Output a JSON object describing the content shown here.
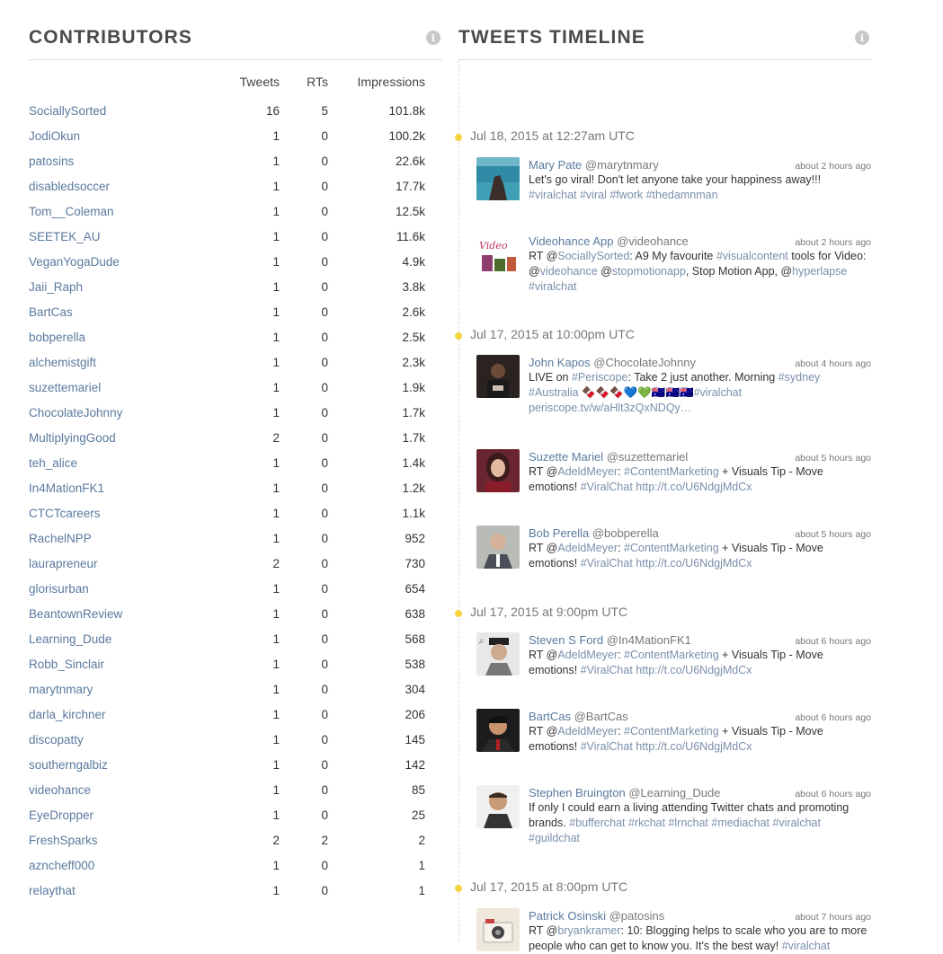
{
  "contributors": {
    "title": "CONTRIBUTORS",
    "info": "i",
    "headers": {
      "name": "",
      "tweets": "Tweets",
      "rts": "RTs",
      "impressions": "Impressions"
    },
    "rows": [
      {
        "name": "SociallySorted",
        "tweets": "16",
        "rts": "5",
        "impressions": "101.8k"
      },
      {
        "name": "JodiOkun",
        "tweets": "1",
        "rts": "0",
        "impressions": "100.2k"
      },
      {
        "name": "patosins",
        "tweets": "1",
        "rts": "0",
        "impressions": "22.6k"
      },
      {
        "name": "disabledsoccer",
        "tweets": "1",
        "rts": "0",
        "impressions": "17.7k"
      },
      {
        "name": "Tom__Coleman",
        "tweets": "1",
        "rts": "0",
        "impressions": "12.5k"
      },
      {
        "name": "SEETEK_AU",
        "tweets": "1",
        "rts": "0",
        "impressions": "11.6k"
      },
      {
        "name": "VeganYogaDude",
        "tweets": "1",
        "rts": "0",
        "impressions": "4.9k"
      },
      {
        "name": "Jaii_Raph",
        "tweets": "1",
        "rts": "0",
        "impressions": "3.8k"
      },
      {
        "name": "BartCas",
        "tweets": "1",
        "rts": "0",
        "impressions": "2.6k"
      },
      {
        "name": "bobperella",
        "tweets": "1",
        "rts": "0",
        "impressions": "2.5k"
      },
      {
        "name": "alchemistgift",
        "tweets": "1",
        "rts": "0",
        "impressions": "2.3k"
      },
      {
        "name": "suzettemariel",
        "tweets": "1",
        "rts": "0",
        "impressions": "1.9k"
      },
      {
        "name": "ChocolateJohnny",
        "tweets": "1",
        "rts": "0",
        "impressions": "1.7k"
      },
      {
        "name": "MultiplyingGood",
        "tweets": "2",
        "rts": "0",
        "impressions": "1.7k"
      },
      {
        "name": "teh_alice",
        "tweets": "1",
        "rts": "0",
        "impressions": "1.4k"
      },
      {
        "name": "In4MationFK1",
        "tweets": "1",
        "rts": "0",
        "impressions": "1.2k"
      },
      {
        "name": "CTCTcareers",
        "tweets": "1",
        "rts": "0",
        "impressions": "1.1k"
      },
      {
        "name": "RachelNPP",
        "tweets": "1",
        "rts": "0",
        "impressions": "952"
      },
      {
        "name": "laurapreneur",
        "tweets": "2",
        "rts": "0",
        "impressions": "730"
      },
      {
        "name": "glorisurban",
        "tweets": "1",
        "rts": "0",
        "impressions": "654"
      },
      {
        "name": "BeantownReview",
        "tweets": "1",
        "rts": "0",
        "impressions": "638"
      },
      {
        "name": "Learning_Dude",
        "tweets": "1",
        "rts": "0",
        "impressions": "568"
      },
      {
        "name": "Robb_Sinclair",
        "tweets": "1",
        "rts": "0",
        "impressions": "538"
      },
      {
        "name": "marytnmary",
        "tweets": "1",
        "rts": "0",
        "impressions": "304"
      },
      {
        "name": "darla_kirchner",
        "tweets": "1",
        "rts": "0",
        "impressions": "206"
      },
      {
        "name": "discopatty",
        "tweets": "1",
        "rts": "0",
        "impressions": "145"
      },
      {
        "name": "southerngalbiz",
        "tweets": "1",
        "rts": "0",
        "impressions": "142"
      },
      {
        "name": "videohance",
        "tweets": "1",
        "rts": "0",
        "impressions": "85"
      },
      {
        "name": "EyeDropper",
        "tweets": "1",
        "rts": "0",
        "impressions": "25"
      },
      {
        "name": "FreshSparks",
        "tweets": "2",
        "rts": "2",
        "impressions": "2"
      },
      {
        "name": "azncheff000",
        "tweets": "1",
        "rts": "0",
        "impressions": "1"
      },
      {
        "name": "relaythat",
        "tweets": "1",
        "rts": "0",
        "impressions": "1"
      }
    ]
  },
  "timeline": {
    "title": "TWEETS TIMELINE",
    "info": "i",
    "groups": [
      {
        "date": "Jul 18, 2015 at 12:27am UTC",
        "tweets": [
          {
            "name": "Mary Pate",
            "handle": "@marytnmary",
            "time": "about 2 hours ago",
            "avatar": "ocean-rock-avatar",
            "parts": [
              {
                "t": "Let's go viral! Don't let anyone take your happiness away!!!"
              },
              {
                "br": 1
              },
              {
                "t": "#viralchat #viral #fwork #thedamnman",
                "link": 1
              }
            ]
          },
          {
            "name": "Videohance App",
            "handle": "@videohance",
            "time": "about 2 hours ago",
            "avatar": "videohance-logo-avatar",
            "parts": [
              {
                "t": "RT @"
              },
              {
                "t": "SociallySorted",
                "link": 1
              },
              {
                "t": ": A9 My favourite "
              },
              {
                "t": "#visualcontent",
                "link": 1
              },
              {
                "t": " tools for Video:"
              },
              {
                "br": 1
              },
              {
                "t": "@"
              },
              {
                "t": "videohance",
                "link": 1
              },
              {
                "t": " @"
              },
              {
                "t": "stopmotionapp",
                "link": 1
              },
              {
                "t": ", Stop Motion App, @"
              },
              {
                "t": "hyperlapse",
                "link": 1
              },
              {
                "br": 1
              },
              {
                "t": "#viralchat",
                "link": 1
              }
            ]
          }
        ]
      },
      {
        "date": "Jul 17, 2015 at 10:00pm UTC",
        "tweets": [
          {
            "name": "John Kapos",
            "handle": "@ChocolateJohnny",
            "time": "about 4 hours ago",
            "avatar": "dark-photo-avatar",
            "parts": [
              {
                "t": "LIVE on "
              },
              {
                "t": "#Periscope",
                "link": 1
              },
              {
                "t": ": Take 2 just another. Morning "
              },
              {
                "t": "#sydney",
                "link": 1
              },
              {
                "br": 1
              },
              {
                "t": "#Australia",
                "link": 1
              },
              {
                "t": " 🍫🍫🍫💙💚🇦🇺🇦🇺🇦🇺"
              },
              {
                "t": "#viralchat",
                "link": 1
              },
              {
                "br": 1
              },
              {
                "t": "periscope.tv/w/aHlt3zQxNDQy…",
                "link": 1
              }
            ]
          },
          {
            "name": "Suzette Mariel",
            "handle": "@suzettemariel",
            "time": "about 5 hours ago",
            "avatar": "woman-portrait-avatar",
            "parts": [
              {
                "t": "RT @"
              },
              {
                "t": "AdeldMeyer",
                "link": 1
              },
              {
                "t": ": "
              },
              {
                "t": "#ContentMarketing",
                "link": 1
              },
              {
                "t": " + Visuals Tip - Move"
              },
              {
                "br": 1
              },
              {
                "t": "emotions! "
              },
              {
                "t": "#ViralChat",
                "link": 1
              },
              {
                "t": " "
              },
              {
                "t": "http://t.co/U6NdgjMdCx",
                "link": 1
              }
            ]
          },
          {
            "name": "Bob Perella",
            "handle": "@bobperella",
            "time": "about 5 hours ago",
            "avatar": "man-suit-avatar",
            "parts": [
              {
                "t": "RT @"
              },
              {
                "t": "AdeldMeyer",
                "link": 1
              },
              {
                "t": ": "
              },
              {
                "t": "#ContentMarketing",
                "link": 1
              },
              {
                "t": " + Visuals Tip - Move"
              },
              {
                "br": 1
              },
              {
                "t": "emotions! "
              },
              {
                "t": "#ViralChat",
                "link": 1
              },
              {
                "t": " "
              },
              {
                "t": "http://t.co/U6NdgjMdCx",
                "link": 1
              }
            ]
          }
        ]
      },
      {
        "date": "Jul 17, 2015 at 9:00pm UTC",
        "tweets": [
          {
            "name": "Steven S Ford",
            "handle": "@In4MationFK1",
            "time": "about 6 hours ago",
            "avatar": "man-hat-avatar",
            "parts": [
              {
                "t": "RT @"
              },
              {
                "t": "AdeldMeyer",
                "link": 1
              },
              {
                "t": ": "
              },
              {
                "t": "#ContentMarketing",
                "link": 1
              },
              {
                "t": " + Visuals Tip - Move"
              },
              {
                "br": 1
              },
              {
                "t": "emotions! "
              },
              {
                "t": "#ViralChat",
                "link": 1
              },
              {
                "t": " "
              },
              {
                "t": "http://t.co/U6NdgjMdCx",
                "link": 1
              }
            ]
          },
          {
            "name": "BartCas",
            "handle": "@BartCas",
            "time": "about 6 hours ago",
            "avatar": "man-dark-avatar",
            "parts": [
              {
                "t": "RT @"
              },
              {
                "t": "AdeldMeyer",
                "link": 1
              },
              {
                "t": ": "
              },
              {
                "t": "#ContentMarketing",
                "link": 1
              },
              {
                "t": " + Visuals Tip - Move"
              },
              {
                "br": 1
              },
              {
                "t": "emotions! "
              },
              {
                "t": "#ViralChat",
                "link": 1
              },
              {
                "t": " "
              },
              {
                "t": "http://t.co/U6NdgjMdCx",
                "link": 1
              }
            ]
          },
          {
            "name": "Stephen Bruington",
            "handle": "@Learning_Dude",
            "time": "about 6 hours ago",
            "avatar": "man-smile-avatar",
            "parts": [
              {
                "t": "If only I could earn a living attending Twitter chats and promoting"
              },
              {
                "br": 1
              },
              {
                "t": "brands. "
              },
              {
                "t": "#bufferchat #rkchat #lrnchat #mediachat #viralchat",
                "link": 1
              },
              {
                "br": 1
              },
              {
                "t": "#guildchat",
                "link": 1
              }
            ]
          }
        ]
      },
      {
        "date": "Jul 17, 2015 at 8:00pm UTC",
        "tweets": [
          {
            "name": "Patrick Osinski",
            "handle": "@patosins",
            "time": "about 7 hours ago",
            "avatar": "camera-avatar",
            "parts": [
              {
                "t": "RT @"
              },
              {
                "t": "bryankramer",
                "link": 1
              },
              {
                "t": ": 10: Blogging helps to scale who you are to more"
              },
              {
                "br": 1
              },
              {
                "t": "people who can get to know you. It's the best way! "
              },
              {
                "t": "#viralchat",
                "link": 1
              }
            ]
          }
        ]
      }
    ]
  }
}
